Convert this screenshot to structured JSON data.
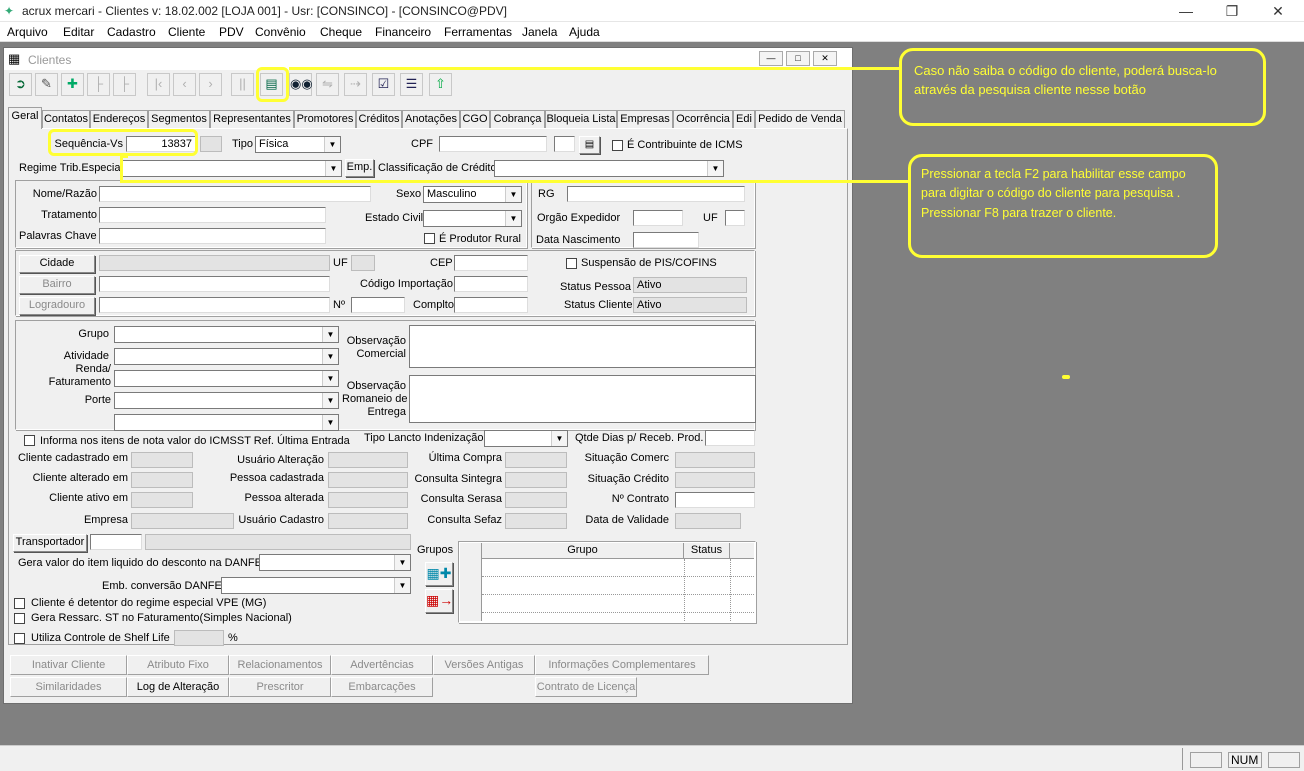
{
  "app": {
    "title": "acrux mercari - Clientes  v: 18.02.002   [LOJA 001] - Usr: [CONSINCO] - [CONSINCO@PDV]"
  },
  "menu": [
    "Arquivo",
    "Editar",
    "Cadastro",
    "Cliente",
    "PDV",
    "Convênio",
    "Cheque",
    "Financeiro",
    "Ferramentas",
    "Janela",
    "Ajuda"
  ],
  "window": {
    "title": "Clientes"
  },
  "toolbar": {
    "icons": [
      "exit-icon",
      "eraser-icon",
      "add-icon",
      "tree-icon",
      "tree-disabled-icon",
      "first-icon",
      "prev-icon",
      "next-icon",
      "last-icon",
      "list-search-icon",
      "binoculars-icon",
      "link-icon",
      "export-icon",
      "checklist-icon",
      "tree-list-icon",
      "upload-icon"
    ]
  },
  "tabs": [
    "Geral",
    "Contatos",
    "Endereços",
    "Segmentos",
    "Representantes",
    "Promotores",
    "Créditos",
    "Anotações",
    "CGO",
    "Cobrança",
    "Bloqueia Lista",
    "Empresas",
    "Ocorrência",
    "Edi",
    "Pedido de Venda"
  ],
  "form": {
    "seq_label": "Sequência-Vs",
    "seq_value": "13837",
    "tipo_label": "Tipo",
    "tipo_value": "Física",
    "cpf_label": "CPF",
    "icms_label": "É Contribuinte de ICMS",
    "regime_label": "Regime Trib.Especial",
    "emp_button": "Emp.",
    "classif_label": "Classificação de Crédito",
    "nome_label": "Nome/Razão",
    "sexo_label": "Sexo",
    "sexo_value": "Masculino",
    "rg_label": "RG",
    "tratamento_label": "Tratamento",
    "estado_civil_label": "Estado Civil",
    "orgao_label": "Orgão Expedidor",
    "uf_label": "UF",
    "palavras_label": "Palavras Chave",
    "produtor_label": "É Produtor Rural",
    "nasc_label": "Data Nascimento",
    "cidade_button": "Cidade",
    "uf2_label": "UF",
    "cep_label": "CEP",
    "suspensao_label": "Suspensão de PIS/COFINS",
    "bairro_button": "Bairro",
    "cod_import_label": "Código Importação",
    "status_pessoa_label": "Status Pessoa",
    "status_pessoa_value": "Ativo",
    "logradouro_button": "Logradouro",
    "num_label": "Nº",
    "compl_label": "Complto",
    "status_cliente_label": "Status Cliente",
    "status_cliente_value": "Ativo",
    "grupo_label": "Grupo",
    "atividade_label": "Atividade",
    "renda_label1": "Renda/",
    "renda_label2": "Faturamento",
    "porte_label": "Porte",
    "obs_com_label1": "Observação",
    "obs_com_label2": "Comercial",
    "obs_rom_label1": "Observação",
    "obs_rom_label2": "Romaneio de",
    "obs_rom_label3": "Entrega",
    "informa_label": "Informa nos itens de nota valor do ICMSST Ref. Última Entrada",
    "tipo_lancto_label": "Tipo Lancto Indenização",
    "qtde_dias_label": "Qtde Dias p/ Receb. Prod.",
    "cli_cad_label": "Cliente cadastrado em",
    "usr_alt_label": "Usuário Alteração",
    "ult_compra_label": "Última Compra",
    "sit_comerc_label": "Situação Comerc",
    "cli_alt_label": "Cliente alterado em",
    "pes_cad_label": "Pessoa cadastrada",
    "cons_sintegra_label": "Consulta Sintegra",
    "sit_credito_label": "Situação Crédito",
    "cli_ativo_label": "Cliente ativo em",
    "pes_alt_label": "Pessoa alterada",
    "cons_serasa_label": "Consulta Serasa",
    "num_contrato_label": "Nº Contrato",
    "empresa_label": "Empresa",
    "usr_cad_label": "Usuário Cadastro",
    "cons_sefaz_label": "Consulta Sefaz",
    "data_validade_label": "Data de Validade",
    "transportador_button": "Transportador",
    "gera_valor_label": "Gera valor do item liquido do desconto na DANFE",
    "emb_label": "Emb. conversão DANFE",
    "vpe_label": "Cliente é detentor do regime especial VPE (MG)",
    "ressarc_label": "Gera Ressarc. ST no Faturamento(Simples Nacional)",
    "shelf_label": "Utiliza Controle de Shelf Life",
    "pct": "%",
    "grupos_label": "Grupos",
    "grid_col_grupo": "Grupo",
    "grid_col_status": "Status"
  },
  "bottom_buttons": {
    "row1": [
      "Inativar Cliente",
      "Atributo Fixo",
      "Relacionamentos",
      "Advertências",
      "Versões Antigas",
      "Informações Complementares"
    ],
    "row2": [
      "Similaridades",
      "Log de Alteração",
      "Prescritor",
      "Embarcações",
      "",
      "Contrato de Licença"
    ]
  },
  "callouts": {
    "c1": "Caso não saiba o código do cliente, poderá busca-lo através da pesquisa cliente nesse botão",
    "c2a": "Pressionar a tecla F2 para habilitar esse campo para digitar o código do cliente para pesquisa .",
    "c2b": "Pressionar F8 para trazer o cliente."
  },
  "status": {
    "num": "NUM"
  },
  "colors": {
    "annotation": "#ffff33",
    "desktop": "#808080",
    "form_bg": "#f0f0f0"
  }
}
